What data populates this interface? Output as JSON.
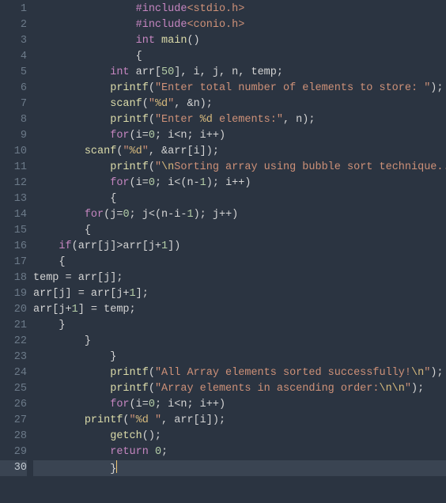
{
  "editor": {
    "active_line": 30,
    "lines": [
      {
        "n": 1,
        "indent": "                ",
        "tokens": [
          {
            "t": "#include",
            "c": "inc"
          },
          {
            "t": "<stdio.h>",
            "c": "hdr"
          }
        ]
      },
      {
        "n": 2,
        "indent": "                ",
        "tokens": [
          {
            "t": "#include",
            "c": "inc"
          },
          {
            "t": "<conio.h>",
            "c": "hdr"
          }
        ]
      },
      {
        "n": 3,
        "indent": "                ",
        "tokens": [
          {
            "t": "int",
            "c": "kw"
          },
          {
            "t": " ",
            "c": "punc"
          },
          {
            "t": "main",
            "c": "fn"
          },
          {
            "t": "()",
            "c": "punc"
          }
        ]
      },
      {
        "n": 4,
        "indent": "                ",
        "tokens": [
          {
            "t": "{",
            "c": "punc"
          }
        ]
      },
      {
        "n": 5,
        "indent": "            ",
        "tokens": [
          {
            "t": "int",
            "c": "kw"
          },
          {
            "t": " arr[",
            "c": "punc"
          },
          {
            "t": "50",
            "c": "num"
          },
          {
            "t": "], i, j, n, temp;",
            "c": "punc"
          }
        ]
      },
      {
        "n": 6,
        "indent": "            ",
        "tokens": [
          {
            "t": "printf",
            "c": "fn"
          },
          {
            "t": "(",
            "c": "punc"
          },
          {
            "t": "\"Enter total number of elements to store: \"",
            "c": "str"
          },
          {
            "t": ");",
            "c": "punc"
          }
        ]
      },
      {
        "n": 7,
        "indent": "            ",
        "tokens": [
          {
            "t": "scanf",
            "c": "fn"
          },
          {
            "t": "(",
            "c": "punc"
          },
          {
            "t": "\"",
            "c": "str"
          },
          {
            "t": "%d",
            "c": "esc"
          },
          {
            "t": "\"",
            "c": "str"
          },
          {
            "t": ", &n);",
            "c": "punc"
          }
        ]
      },
      {
        "n": 8,
        "indent": "            ",
        "tokens": [
          {
            "t": "printf",
            "c": "fn"
          },
          {
            "t": "(",
            "c": "punc"
          },
          {
            "t": "\"Enter ",
            "c": "str"
          },
          {
            "t": "%d",
            "c": "esc"
          },
          {
            "t": " elements:\"",
            "c": "str"
          },
          {
            "t": ", n);",
            "c": "punc"
          }
        ]
      },
      {
        "n": 9,
        "indent": "            ",
        "tokens": [
          {
            "t": "for",
            "c": "kw"
          },
          {
            "t": "(i=",
            "c": "punc"
          },
          {
            "t": "0",
            "c": "num"
          },
          {
            "t": "; i<n; i++)",
            "c": "punc"
          }
        ]
      },
      {
        "n": 10,
        "indent": "        ",
        "tokens": [
          {
            "t": "scanf",
            "c": "fn"
          },
          {
            "t": "(",
            "c": "punc"
          },
          {
            "t": "\"",
            "c": "str"
          },
          {
            "t": "%d",
            "c": "esc"
          },
          {
            "t": "\"",
            "c": "str"
          },
          {
            "t": ", &arr[i]);",
            "c": "punc"
          }
        ]
      },
      {
        "n": 11,
        "indent": "            ",
        "tokens": [
          {
            "t": "printf",
            "c": "fn"
          },
          {
            "t": "(",
            "c": "punc"
          },
          {
            "t": "\"",
            "c": "str"
          },
          {
            "t": "\\n",
            "c": "esc"
          },
          {
            "t": "Sorting array using bubble sort technique...",
            "c": "str"
          },
          {
            "t": "\\n",
            "c": "esc"
          },
          {
            "t": "\"",
            "c": "str"
          },
          {
            "t": ");",
            "c": "punc"
          }
        ]
      },
      {
        "n": 12,
        "indent": "            ",
        "tokens": [
          {
            "t": "for",
            "c": "kw"
          },
          {
            "t": "(i=",
            "c": "punc"
          },
          {
            "t": "0",
            "c": "num"
          },
          {
            "t": "; i<(n-",
            "c": "punc"
          },
          {
            "t": "1",
            "c": "num"
          },
          {
            "t": "); i++)",
            "c": "punc"
          }
        ]
      },
      {
        "n": 13,
        "indent": "            ",
        "tokens": [
          {
            "t": "{",
            "c": "punc"
          }
        ]
      },
      {
        "n": 14,
        "indent": "        ",
        "tokens": [
          {
            "t": "for",
            "c": "kw"
          },
          {
            "t": "(j=",
            "c": "punc"
          },
          {
            "t": "0",
            "c": "num"
          },
          {
            "t": "; j<(n-i-",
            "c": "punc"
          },
          {
            "t": "1",
            "c": "num"
          },
          {
            "t": "); j++)",
            "c": "punc"
          }
        ]
      },
      {
        "n": 15,
        "indent": "        ",
        "tokens": [
          {
            "t": "{",
            "c": "punc"
          }
        ]
      },
      {
        "n": 16,
        "indent": "    ",
        "tokens": [
          {
            "t": "if",
            "c": "kw"
          },
          {
            "t": "(arr[j]>arr[j+",
            "c": "punc"
          },
          {
            "t": "1",
            "c": "num"
          },
          {
            "t": "])",
            "c": "punc"
          }
        ]
      },
      {
        "n": 17,
        "indent": "    ",
        "tokens": [
          {
            "t": "{",
            "c": "punc"
          }
        ]
      },
      {
        "n": 18,
        "indent": "",
        "tokens": [
          {
            "t": "temp = arr[j];",
            "c": "punc"
          }
        ]
      },
      {
        "n": 19,
        "indent": "",
        "tokens": [
          {
            "t": "arr[j] = arr[j+",
            "c": "punc"
          },
          {
            "t": "1",
            "c": "num"
          },
          {
            "t": "];",
            "c": "punc"
          }
        ]
      },
      {
        "n": 20,
        "indent": "",
        "tokens": [
          {
            "t": "arr[j+",
            "c": "punc"
          },
          {
            "t": "1",
            "c": "num"
          },
          {
            "t": "] = temp;",
            "c": "punc"
          }
        ]
      },
      {
        "n": 21,
        "indent": "    ",
        "tokens": [
          {
            "t": "}",
            "c": "punc"
          }
        ]
      },
      {
        "n": 22,
        "indent": "        ",
        "tokens": [
          {
            "t": "}",
            "c": "punc"
          }
        ]
      },
      {
        "n": 23,
        "indent": "            ",
        "tokens": [
          {
            "t": "}",
            "c": "punc"
          }
        ]
      },
      {
        "n": 24,
        "indent": "            ",
        "tokens": [
          {
            "t": "printf",
            "c": "fn"
          },
          {
            "t": "(",
            "c": "punc"
          },
          {
            "t": "\"All Array elements sorted successfully!",
            "c": "str"
          },
          {
            "t": "\\n",
            "c": "esc"
          },
          {
            "t": "\"",
            "c": "str"
          },
          {
            "t": ");",
            "c": "punc"
          }
        ]
      },
      {
        "n": 25,
        "indent": "            ",
        "tokens": [
          {
            "t": "printf",
            "c": "fn"
          },
          {
            "t": "(",
            "c": "punc"
          },
          {
            "t": "\"Array elements in ascending order:",
            "c": "str"
          },
          {
            "t": "\\n\\n",
            "c": "esc"
          },
          {
            "t": "\"",
            "c": "str"
          },
          {
            "t": ");",
            "c": "punc"
          }
        ]
      },
      {
        "n": 26,
        "indent": "            ",
        "tokens": [
          {
            "t": "for",
            "c": "kw"
          },
          {
            "t": "(i=",
            "c": "punc"
          },
          {
            "t": "0",
            "c": "num"
          },
          {
            "t": "; i<n; i++)",
            "c": "punc"
          }
        ]
      },
      {
        "n": 27,
        "indent": "        ",
        "tokens": [
          {
            "t": "printf",
            "c": "fn"
          },
          {
            "t": "(",
            "c": "punc"
          },
          {
            "t": "\"",
            "c": "str"
          },
          {
            "t": "%d",
            "c": "esc"
          },
          {
            "t": " \"",
            "c": "str"
          },
          {
            "t": ", arr[i]);",
            "c": "punc"
          }
        ]
      },
      {
        "n": 28,
        "indent": "            ",
        "tokens": [
          {
            "t": "getch",
            "c": "fn"
          },
          {
            "t": "();",
            "c": "punc"
          }
        ]
      },
      {
        "n": 29,
        "indent": "            ",
        "tokens": [
          {
            "t": "return",
            "c": "kw"
          },
          {
            "t": " ",
            "c": "punc"
          },
          {
            "t": "0",
            "c": "num"
          },
          {
            "t": ";",
            "c": "punc"
          }
        ]
      },
      {
        "n": 30,
        "indent": "            ",
        "tokens": [
          {
            "t": "}",
            "c": "punc"
          }
        ]
      }
    ]
  }
}
